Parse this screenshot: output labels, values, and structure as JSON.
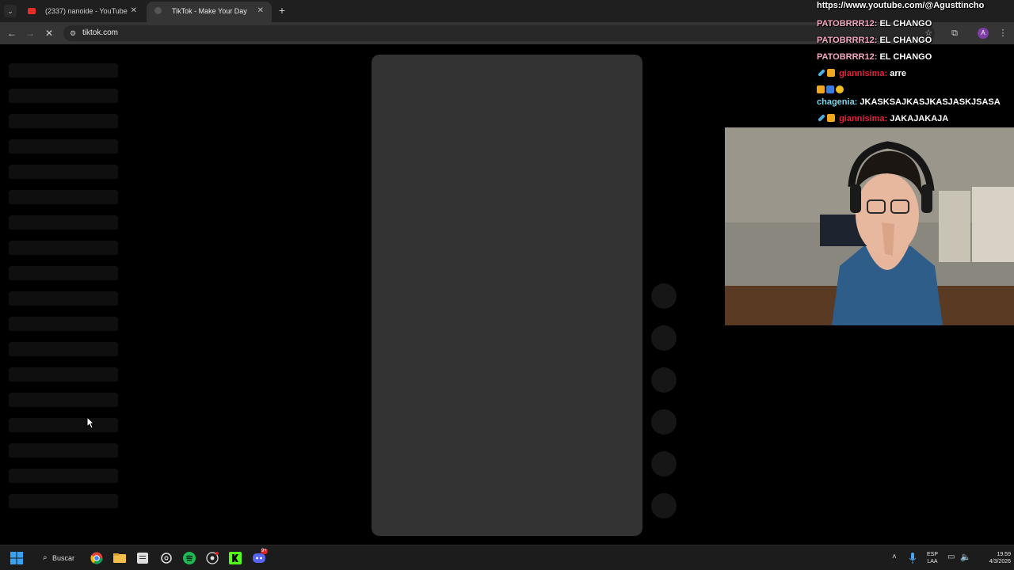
{
  "browser": {
    "tabs": [
      {
        "label": "(2337) nanoide - YouTube",
        "active": false,
        "favicon": "youtube-icon"
      },
      {
        "label": "TikTok - Make Your Day",
        "active": true,
        "favicon": "tiktok-icon"
      }
    ],
    "url": "tiktok.com",
    "profile_initial": "A"
  },
  "stream_overlay": {
    "channel_url": "https://www.youtube.com/@Agusttincho",
    "chat": [
      {
        "user": "PATOBRRR12:",
        "message": "EL CHANGO",
        "color": "#f4a8c0"
      },
      {
        "user": "PATOBRRR12:",
        "message": "EL CHANGO",
        "color": "#f4a8c0"
      },
      {
        "user": "PATOBRRR12:",
        "message": "EL CHANGO",
        "color": "#f4a8c0"
      },
      {
        "user": "giannisima:",
        "message": "arre",
        "color": "#e0213a"
      },
      {
        "user": "chagenia:",
        "message": "JKASKSAJKASJKASJASKJSASA",
        "color": "#7ed3e8"
      },
      {
        "user": "giannisima:",
        "message": "JAKAJAKAJA",
        "color": "#e0213a"
      }
    ]
  },
  "taskbar": {
    "search_label": "Buscar",
    "language": "ESP",
    "keyboard": "LAA",
    "time": "19:59",
    "date": "4/3/2026",
    "discord_badge": "9+"
  },
  "colors": {
    "page_bg": "#000000",
    "card": "#333333",
    "toolbar": "#353535",
    "tabbar": "#1f1f1f"
  }
}
